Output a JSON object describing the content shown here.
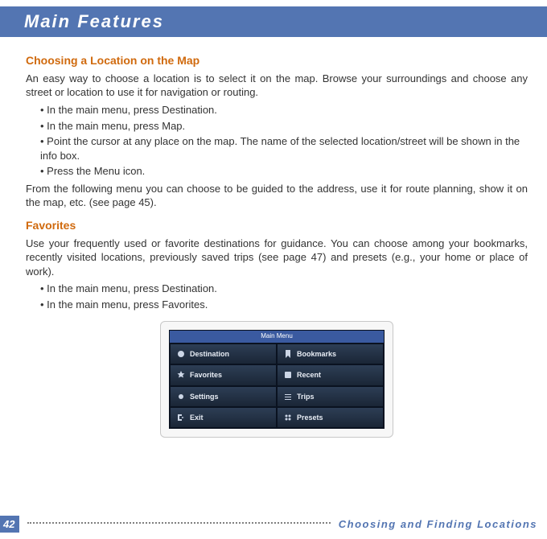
{
  "header": {
    "title": "Main Features"
  },
  "section1": {
    "heading": "Choosing a Location on the Map",
    "intro": "An easy way to choose a location is to select it on the map. Browse your surroundings and choose any street or location to use it for navigation or routing.",
    "bullets": [
      "In the main menu, press Destination.",
      "In the main menu, press Map.",
      "Point the cursor at any place on the map. The name of the selected location/street will be shown in the info box.",
      "Press the Menu icon."
    ],
    "outro": "From the following menu you can choose to be guided to the address, use it for route planning, show it on the map, etc. (see page 45)."
  },
  "section2": {
    "heading": "Favorites",
    "intro": "Use your frequently used or favorite destinations for guidance. You can choose among your bookmarks, recently visited locations, previously saved trips (see page 47) and presets (e.g., your home or place of work).",
    "bullets": [
      "In the main menu, press Destination.",
      "In the main menu, press Favorites."
    ]
  },
  "menu_screenshot": {
    "title": "Main Menu",
    "items": [
      {
        "label": "Destination",
        "icon": "destination-icon"
      },
      {
        "label": "Bookmarks",
        "icon": "bookmarks-icon"
      },
      {
        "label": "Favorites",
        "icon": "favorites-icon"
      },
      {
        "label": "Recent",
        "icon": "recent-icon"
      },
      {
        "label": "Settings",
        "icon": "settings-icon"
      },
      {
        "label": "Trips",
        "icon": "trips-icon"
      },
      {
        "label": "Exit",
        "icon": "exit-icon"
      },
      {
        "label": "Presets",
        "icon": "presets-icon"
      }
    ]
  },
  "footer": {
    "page_number": "42",
    "section_label": "Choosing and Finding Locations"
  }
}
